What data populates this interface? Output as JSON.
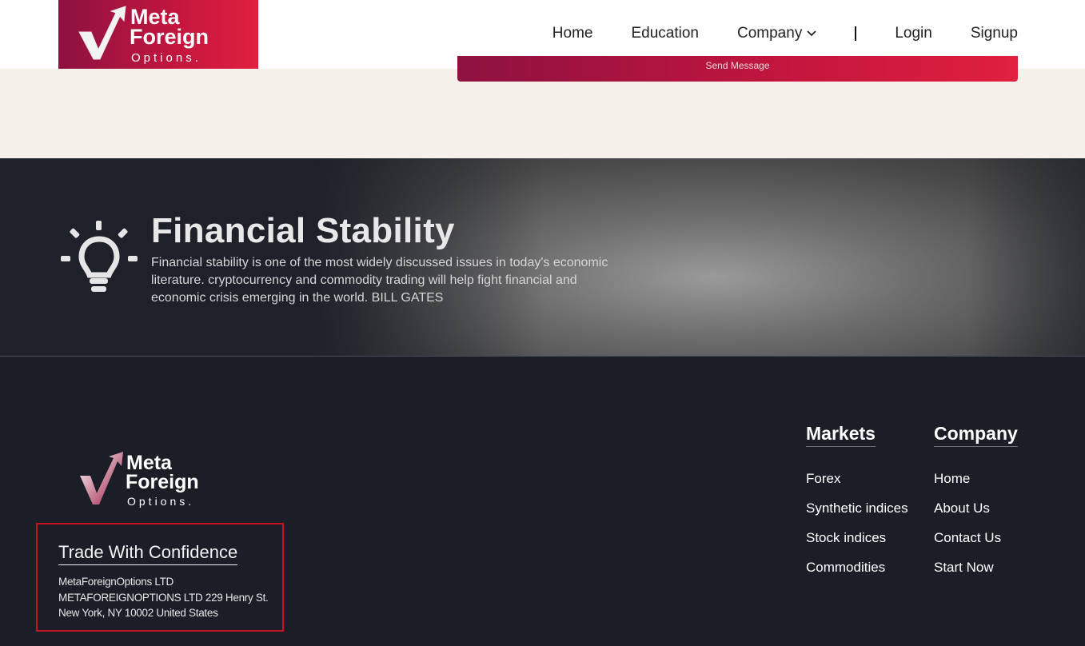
{
  "header": {
    "logo": {
      "line1": "Meta",
      "line2": "Foreign",
      "line3": "Options."
    },
    "nav": {
      "home": "Home",
      "education": "Education",
      "company": "Company",
      "login": "Login",
      "signup": "Signup"
    }
  },
  "contact": {
    "send_button": "Send Message"
  },
  "banner": {
    "title": "Financial Stability",
    "text": "Financial stability is one of the most widely discussed issues in today's economic literature. cryptocurrency and commodity trading will help fight financial and economic crisis emerging in the world. BILL GATES"
  },
  "footer": {
    "logo": {
      "line1": "Meta",
      "line2": "Foreign",
      "line3": "Options."
    },
    "tagline": "Trade With Confidence",
    "address": [
      "MetaForeignOptions LTD",
      "METAFOREIGNOPTIONS LTD 229 Henry St.",
      "New York, NY 10002 United States"
    ],
    "markets": {
      "title": "Markets",
      "items": [
        "Forex",
        "Synthetic indices",
        "Stock indices",
        "Commodities"
      ]
    },
    "company": {
      "title": "Company",
      "items": [
        "Home",
        "About Us",
        "Contact Us",
        "Start Now"
      ]
    }
  },
  "colors": {
    "brand_red": "#c4163e",
    "brand_dark": "#8d1140",
    "footer_bg": "#1b1e26",
    "beige": "#f5f0ea",
    "highlight_border": "#c8141e"
  }
}
